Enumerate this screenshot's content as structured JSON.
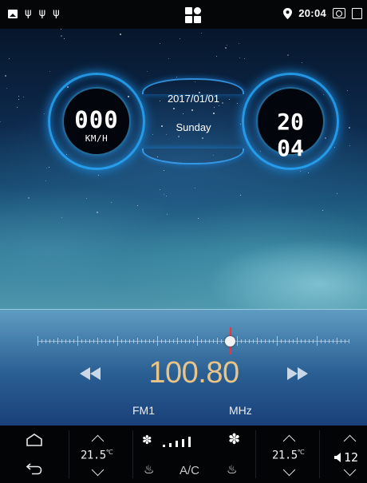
{
  "status_bar": {
    "time": "20:04",
    "left_icons": [
      "image-icon",
      "usb-icon",
      "usb-icon",
      "usb-icon"
    ],
    "center_icon": "app-grid-icon",
    "right_icons": [
      "location-pin-icon",
      "screenshot-icon",
      "recent-apps-icon"
    ]
  },
  "dashboard": {
    "speed_value": "000",
    "speed_unit": "KM/H",
    "date": "2017/01/01",
    "weekday": "Sunday",
    "clock": "20 04"
  },
  "radio": {
    "frequency": "100.80",
    "band": "FM1",
    "unit": "MHz",
    "tuner_position": 0.62,
    "colors": {
      "frequency": "#e9c488",
      "needle": "#ff3030"
    }
  },
  "bottom_bar": {
    "temp_left": "21.5",
    "temp_right": "21.5",
    "temp_unit": "℃",
    "fan_level": 5,
    "ac_label": "A/C",
    "volume": "12",
    "icons": [
      "home-icon",
      "back-icon",
      "fan-icon",
      "seat-heat-icon",
      "volume-icon"
    ]
  }
}
